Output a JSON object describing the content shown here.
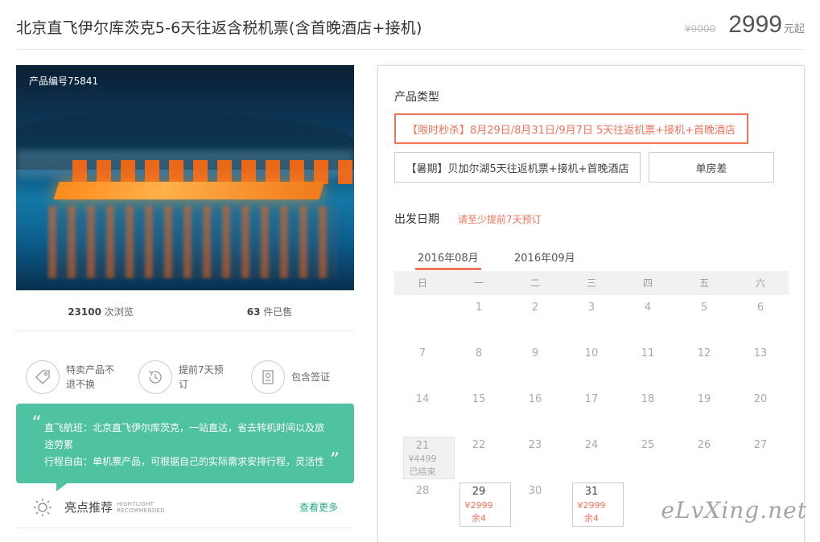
{
  "header": {
    "title": "北京直飞伊尔库茨克5-6天往返含税机票(含首晚酒店+接机)",
    "original_price": "¥9000",
    "price": "2999",
    "price_unit": "元起"
  },
  "product": {
    "code": "产品编号75841",
    "views_count": "23100",
    "views_label": "次浏览",
    "sold_count": "63",
    "sold_label": "件已售"
  },
  "features": [
    {
      "icon": "tag-icon",
      "text": "特卖产品不退不换"
    },
    {
      "icon": "history-clock-icon",
      "text": "提前7天预订"
    },
    {
      "icon": "passport-icon",
      "text": "包含签证"
    }
  ],
  "quote": {
    "open_mark": "“",
    "close_mark": "”",
    "line1": "直飞航班：北京直飞伊尔库茨克，一站直达，省去转机时间以及旅途劳累",
    "line2": "行程自由：单机票产品，可根据自己的实际需求安排行程，灵活性"
  },
  "highlight": {
    "title": "亮点推荐",
    "en_line1": "HIGHTLIGHT",
    "en_line2": "RECOMMENDED",
    "more": "查看更多"
  },
  "booking": {
    "type_label": "产品类型",
    "options": [
      {
        "label": "【限时秒杀】8月29日/8月31日/9月7日 5天往返机票+接机+首晚酒店",
        "selected": true
      },
      {
        "label": "【暑期】贝加尔湖5天往返机票+接机+首晚酒店",
        "selected": false
      },
      {
        "label": "单房差",
        "selected": false
      }
    ],
    "date_label": "出发日期",
    "date_hint": "请至少提前7天预订",
    "months": [
      "2016年08月",
      "2016年09月"
    ],
    "weekdays": [
      "日",
      "一",
      "二",
      "三",
      "四",
      "五",
      "六"
    ],
    "ended_price": "¥4499",
    "ended_status": "已结束",
    "avail_price": "¥2999",
    "avail_stock": "余4",
    "days": [
      "1",
      "2",
      "3",
      "4",
      "5",
      "6",
      "7",
      "8",
      "9",
      "10",
      "11",
      "12",
      "13",
      "14",
      "15",
      "16",
      "17",
      "18",
      "19",
      "20",
      "21",
      "22",
      "23",
      "24",
      "25",
      "26",
      "27",
      "28",
      "29",
      "30",
      "31"
    ]
  },
  "watermark": "eLvXing.net",
  "colors": {
    "accent": "#f0735b",
    "green": "#4fc2a1",
    "link": "#27a882"
  }
}
